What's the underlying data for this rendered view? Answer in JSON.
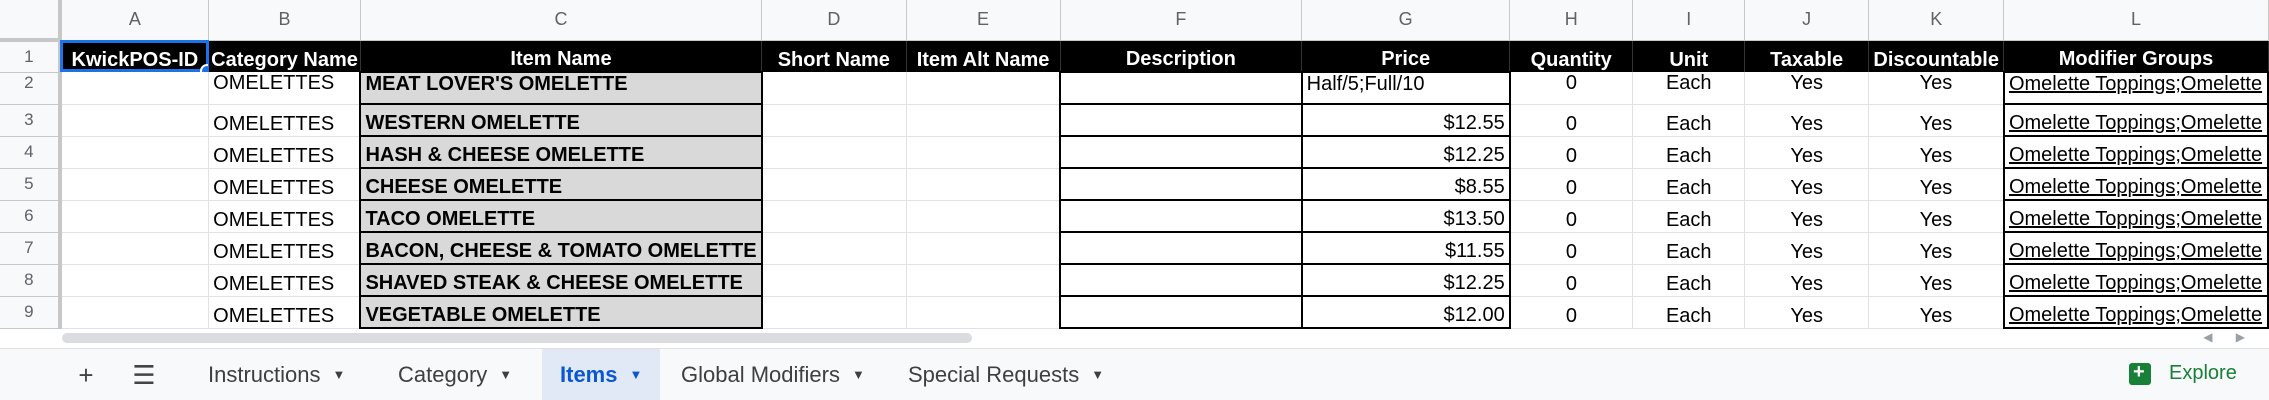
{
  "columns": [
    "A",
    "B",
    "C",
    "D",
    "E",
    "F",
    "G",
    "H",
    "I",
    "J",
    "K",
    "L"
  ],
  "header_row": {
    "num": "1",
    "cells": [
      "KwickPOS-ID",
      "Category Name",
      "Item Name",
      "Short Name",
      "Item Alt Name",
      "Description",
      "Price",
      "Quantity",
      "Unit",
      "Taxable",
      "Discountable",
      "Modifier Groups"
    ]
  },
  "rows": [
    {
      "num": "2",
      "category": "OMELETTES",
      "item": "MEAT LOVER'S OMELETTE",
      "price": "Half/5;Full/10",
      "quantity": "0",
      "unit": "Each",
      "taxable": "Yes",
      "discountable": "Yes",
      "modifiers": "Omelette Toppings;Omelette"
    },
    {
      "num": "3",
      "category": "OMELETTES",
      "item": "WESTERN OMELETTE",
      "price": "$12.55",
      "quantity": "0",
      "unit": "Each",
      "taxable": "Yes",
      "discountable": "Yes",
      "modifiers": "Omelette Toppings;Omelette"
    },
    {
      "num": "4",
      "category": "OMELETTES",
      "item": "HASH & CHEESE OMELETTE",
      "price": "$12.25",
      "quantity": "0",
      "unit": "Each",
      "taxable": "Yes",
      "discountable": "Yes",
      "modifiers": "Omelette Toppings;Omelette"
    },
    {
      "num": "5",
      "category": "OMELETTES",
      "item": "CHEESE OMELETTE",
      "price": "$8.55",
      "quantity": "0",
      "unit": "Each",
      "taxable": "Yes",
      "discountable": "Yes",
      "modifiers": "Omelette Toppings;Omelette"
    },
    {
      "num": "6",
      "category": "OMELETTES",
      "item": "TACO OMELETTE",
      "price": "$13.50",
      "quantity": "0",
      "unit": "Each",
      "taxable": "Yes",
      "discountable": "Yes",
      "modifiers": "Omelette Toppings;Omelette"
    },
    {
      "num": "7",
      "category": "OMELETTES",
      "item": "BACON, CHEESE & TOMATO OMELETTE",
      "price": "$11.55",
      "quantity": "0",
      "unit": "Each",
      "taxable": "Yes",
      "discountable": "Yes",
      "modifiers": "Omelette Toppings;Omelette"
    },
    {
      "num": "8",
      "category": "OMELETTES",
      "item": "SHAVED STEAK & CHEESE OMELETTE",
      "price": "$12.25",
      "quantity": "0",
      "unit": "Each",
      "taxable": "Yes",
      "discountable": "Yes",
      "modifiers": "Omelette Toppings;Omelette"
    },
    {
      "num": "9",
      "category": "OMELETTES",
      "item": "VEGETABLE OMELETTE",
      "price": "$12.00",
      "quantity": "0",
      "unit": "Each",
      "taxable": "Yes",
      "discountable": "Yes",
      "modifiers": "Omelette Toppings;Omelette"
    }
  ],
  "tabs": [
    {
      "label": "Instructions",
      "active": false
    },
    {
      "label": "Category",
      "active": false
    },
    {
      "label": "Items",
      "active": true
    },
    {
      "label": "Global Modifiers",
      "active": false
    },
    {
      "label": "Special Requests",
      "active": false
    }
  ],
  "add_sheet_icon": "plus-icon",
  "all_sheets_icon": "menu-icon",
  "explore_label": "Explore",
  "colors": {
    "accent": "#1a73e8",
    "active_tab_bg": "#e1e9f7",
    "active_tab_text": "#0b57d0",
    "header_bg": "#000000",
    "item_bg": "#d9d9d9",
    "explore": "#188038"
  }
}
